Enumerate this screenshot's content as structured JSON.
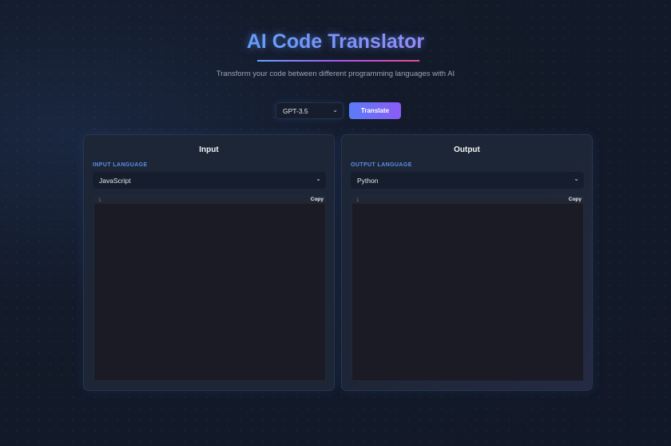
{
  "header": {
    "title": "AI Code Translator",
    "subtitle": "Transform your code between different programming languages with AI"
  },
  "controls": {
    "model": "GPT-3.5",
    "translate_label": "Translate"
  },
  "input": {
    "title": "Input",
    "label": "INPUT LANGUAGE",
    "language": "JavaScript",
    "line_number": "1",
    "copy_label": "Copy"
  },
  "output": {
    "title": "Output",
    "label": "OUTPUT LANGUAGE",
    "language": "Python",
    "line_number": "1",
    "copy_label": "Copy"
  }
}
